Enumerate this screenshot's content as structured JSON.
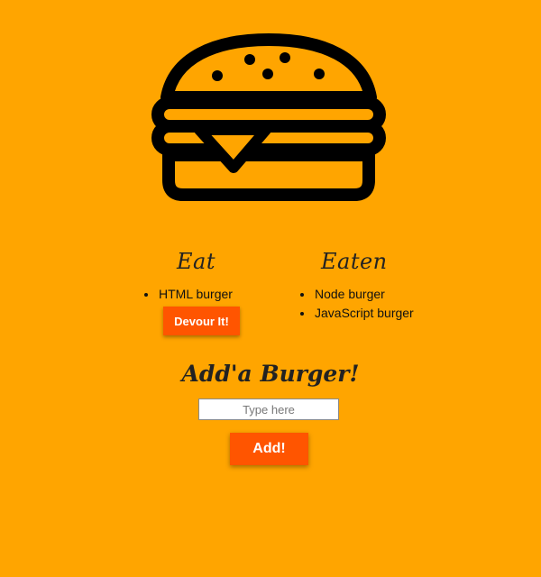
{
  "logo": {
    "icon": "hamburger-icon"
  },
  "eat": {
    "title": "Eat",
    "items": [
      {
        "label": "HTML burger",
        "button_label": "Devour It!"
      }
    ]
  },
  "eaten": {
    "title": "Eaten",
    "items": [
      "Node burger",
      "JavaScript burger"
    ]
  },
  "add_form": {
    "title": "Add'a Burger!",
    "input_placeholder": "Type here",
    "input_value": "",
    "submit_label": "Add!"
  },
  "colors": {
    "background": "#ffa500",
    "button": "#ff5500",
    "button_text": "#ffffff"
  }
}
